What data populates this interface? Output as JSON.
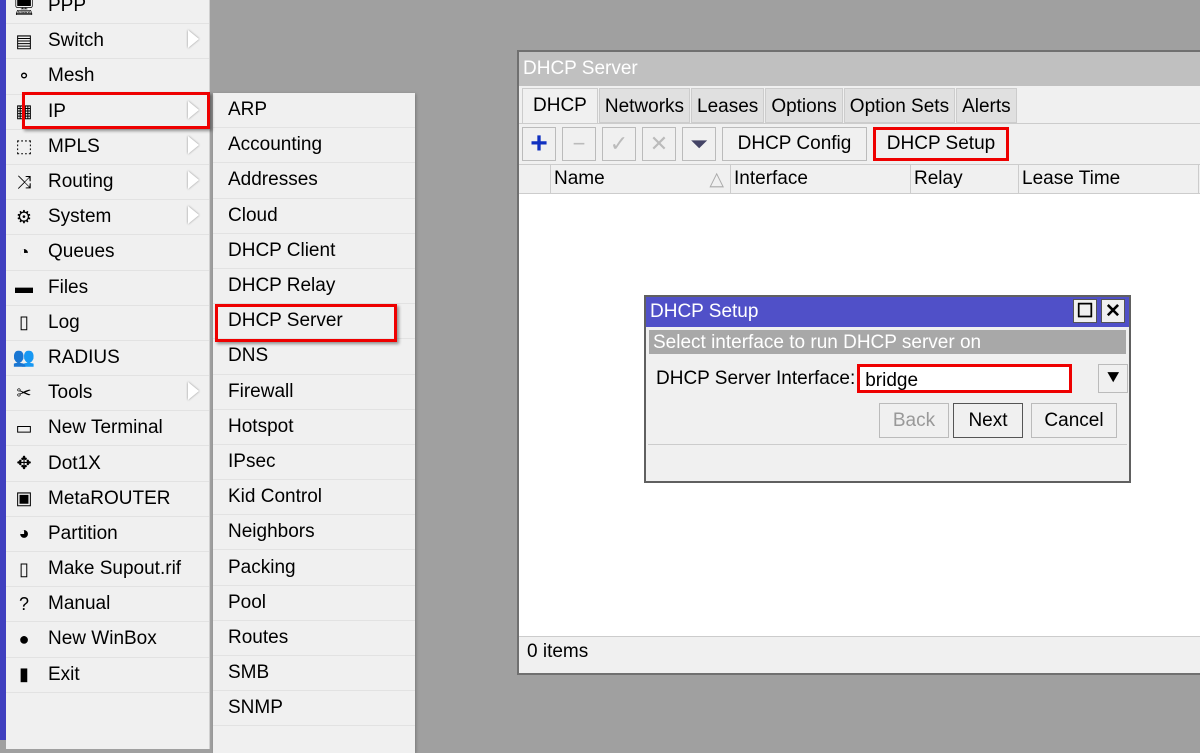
{
  "main_menu": {
    "items": [
      {
        "label": "PPP",
        "icon": "ppp-icon",
        "sym": "🖥",
        "submenu": false
      },
      {
        "label": "Switch",
        "icon": "switch-icon",
        "sym": "▤",
        "submenu": true
      },
      {
        "label": "Mesh",
        "icon": "mesh-icon",
        "sym": "⚬",
        "submenu": false
      },
      {
        "label": "IP",
        "icon": "ip-icon",
        "sym": "▦",
        "submenu": true
      },
      {
        "label": "MPLS",
        "icon": "mpls-icon",
        "sym": "⬚",
        "submenu": true
      },
      {
        "label": "Routing",
        "icon": "routing-icon",
        "sym": "⤨",
        "submenu": true
      },
      {
        "label": "System",
        "icon": "gear-icon",
        "sym": "⚙",
        "submenu": true
      },
      {
        "label": "Queues",
        "icon": "queues-icon",
        "sym": "◔",
        "submenu": false
      },
      {
        "label": "Files",
        "icon": "folder-icon",
        "sym": "▬",
        "submenu": false
      },
      {
        "label": "Log",
        "icon": "log-icon",
        "sym": "▯",
        "submenu": false
      },
      {
        "label": "RADIUS",
        "icon": "radius-icon",
        "sym": "👥",
        "submenu": false
      },
      {
        "label": "Tools",
        "icon": "tools-icon",
        "sym": "✂",
        "submenu": true
      },
      {
        "label": "New Terminal",
        "icon": "terminal-icon",
        "sym": "▭",
        "submenu": false
      },
      {
        "label": "Dot1X",
        "icon": "dot1x-icon",
        "sym": "✥",
        "submenu": false
      },
      {
        "label": "MetaROUTER",
        "icon": "metarouter-icon",
        "sym": "▣",
        "submenu": false
      },
      {
        "label": "Partition",
        "icon": "partition-icon",
        "sym": "◕",
        "submenu": false
      },
      {
        "label": "Make Supout.rif",
        "icon": "supout-icon",
        "sym": "▯",
        "submenu": false
      },
      {
        "label": "Manual",
        "icon": "help-icon",
        "sym": "?",
        "submenu": false
      },
      {
        "label": "New WinBox",
        "icon": "winbox-icon",
        "sym": "●",
        "submenu": false
      },
      {
        "label": "Exit",
        "icon": "exit-icon",
        "sym": "▮",
        "submenu": false
      }
    ]
  },
  "ip_submenu": {
    "items": [
      "ARP",
      "Accounting",
      "Addresses",
      "Cloud",
      "DHCP Client",
      "DHCP Relay",
      "DHCP Server",
      "DNS",
      "Firewall",
      "Hotspot",
      "IPsec",
      "Kid Control",
      "Neighbors",
      "Packing",
      "Pool",
      "Routes",
      "SMB",
      "SNMP"
    ]
  },
  "dhcp_window": {
    "title": "DHCP Server",
    "tabs": [
      "DHCP",
      "Networks",
      "Leases",
      "Options",
      "Option Sets",
      "Alerts"
    ],
    "toolbar": {
      "add": "+",
      "remove": "−",
      "enable": "✓",
      "disable": "✕",
      "filter": "⏷",
      "config": "DHCP Config",
      "setup": "DHCP Setup"
    },
    "columns": [
      "Name",
      "Interface",
      "Relay",
      "Lease Time"
    ],
    "sort_indicator": "△",
    "status": "0 items"
  },
  "dialog": {
    "title": "DHCP Setup",
    "maximize": "☐",
    "close": "✕",
    "description": "Select interface to run DHCP server on",
    "field_label": "DHCP Server Interface:",
    "field_value": "bridge",
    "dropdown": "⯆",
    "back": "Back",
    "next": "Next",
    "cancel": "Cancel"
  },
  "colors": {
    "accent": "#5050c8",
    "highlight": "#e00000"
  }
}
